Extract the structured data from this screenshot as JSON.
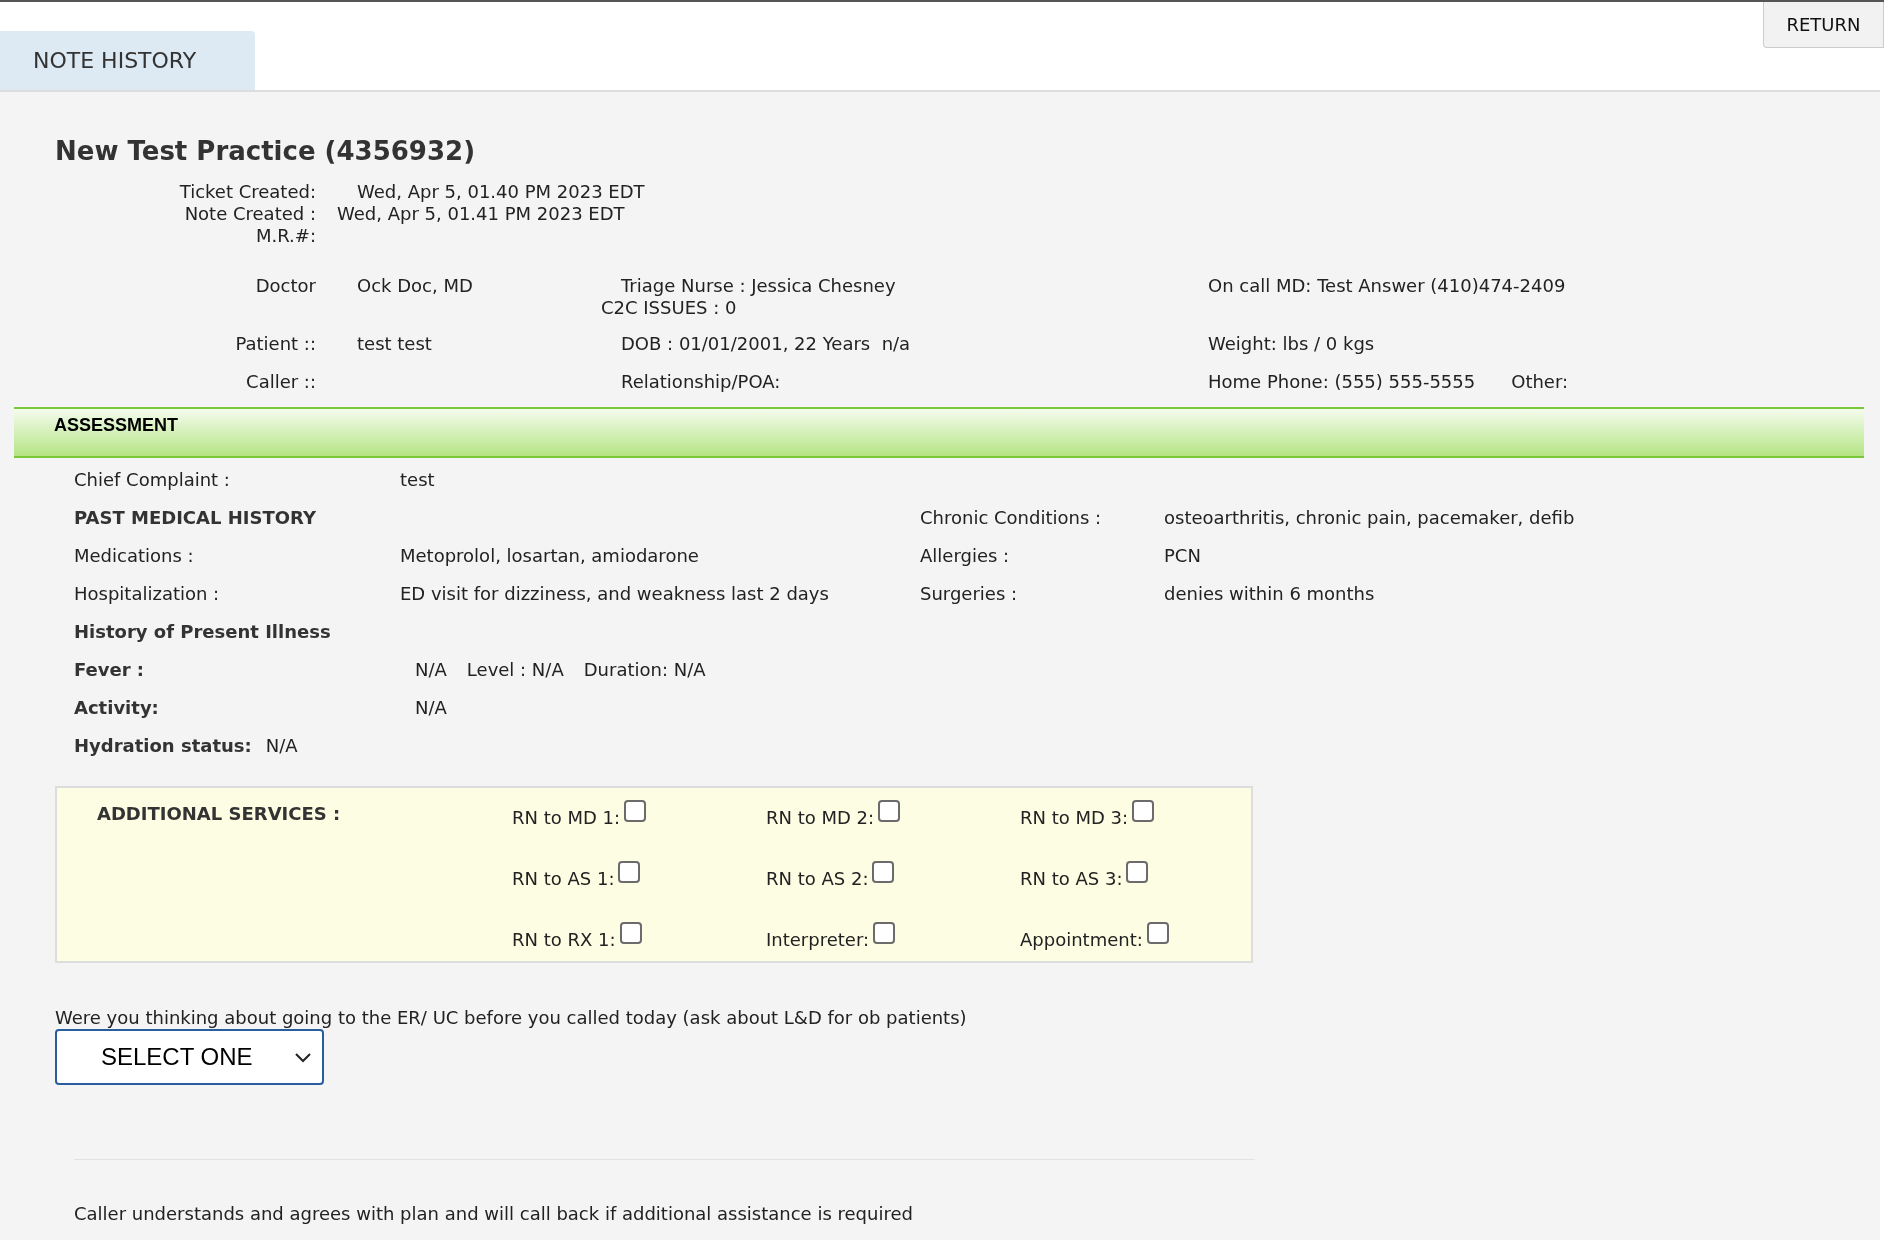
{
  "return_button": "RETURN",
  "tab": {
    "label": "NOTE HISTORY",
    "selected": true
  },
  "title": "New Test Practice (4356932)",
  "created": [
    {
      "label": "Ticket Created:",
      "value": "Wed, Apr 5, 01.40 PM 2023 EDT"
    },
    {
      "label": "Note Created :",
      "value": "Wed, Apr 5, 01.41 PM 2023 EDT"
    },
    {
      "label": "M.R.#:"
    }
  ],
  "info_rows": [
    {
      "label": "Doctor",
      "value": "Ock Doc, MD",
      "middle": [
        "Triage Nurse : Jessica Chesney",
        "C2C ISSUES : 0"
      ],
      "right": [
        "On call MD: Test Answer (410)474-2409"
      ]
    },
    {
      "label": "Patient ::",
      "value": "test test",
      "middle": [
        "DOB : 01/01/2001, 22 Years  n/a"
      ],
      "right": [
        "Weight: lbs / 0 kgs"
      ]
    },
    {
      "label": "Caller ::",
      "middle": [
        "Relationship/POA:"
      ],
      "right": [
        "Home Phone: (555) 555-5555",
        "Other:"
      ]
    }
  ],
  "assessment": {
    "title": "ASSESSMENT",
    "rows": [
      {
        "kind": "pair",
        "label": "Chief Complaint :",
        "value": "test"
      },
      {
        "kind": "heading",
        "label": "PAST MEDICAL HISTORY",
        "right_label": "Chronic Conditions :",
        "right_value": "osteoarthritis, chronic pain, pacemaker, defib"
      },
      {
        "kind": "pair",
        "label": "Medications :",
        "value": "Metoprolol, losartan, amiodarone",
        "right_label": "Allergies :",
        "right_value": "PCN"
      },
      {
        "kind": "pair",
        "label": "Hospitalization :",
        "value": "ED visit for dizziness, and weakness last 2 days",
        "right_label": "Surgeries :",
        "right_value": "denies within 6 months"
      },
      {
        "kind": "heading",
        "label": "History of Present Illness"
      },
      {
        "kind": "bold_pair",
        "label": "Fever :",
        "values": [
          "N/A",
          "Level : N/A",
          "Duration: N/A"
        ]
      },
      {
        "kind": "bold_pair",
        "label": "Activity:",
        "values": [
          "N/A"
        ]
      },
      {
        "kind": "inline",
        "label": "Hydration status:",
        "value": "N/A"
      }
    ]
  },
  "additional_services": {
    "title": "ADDITIONAL SERVICES :",
    "items": [
      {
        "label": "RN to MD 1:",
        "checked": false
      },
      {
        "label": "RN to MD 2:",
        "checked": false
      },
      {
        "label": "RN to MD 3:",
        "checked": false
      },
      {
        "label": "RN to AS 1:",
        "checked": false
      },
      {
        "label": "RN to AS 2:",
        "checked": false
      },
      {
        "label": "RN to AS 3:",
        "checked": false
      },
      {
        "label": "RN to RX 1:",
        "checked": false
      },
      {
        "label": "Interpreter:",
        "checked": false
      },
      {
        "label": "Appointment:",
        "checked": false
      }
    ]
  },
  "question": {
    "text": "Were you thinking about going to the ER/ UC before you called today (ask about L&D for ob patients)",
    "select": "SELECT ONE"
  },
  "footer_note": "Caller understands and agrees with plan and will call back if additional assistance is required"
}
